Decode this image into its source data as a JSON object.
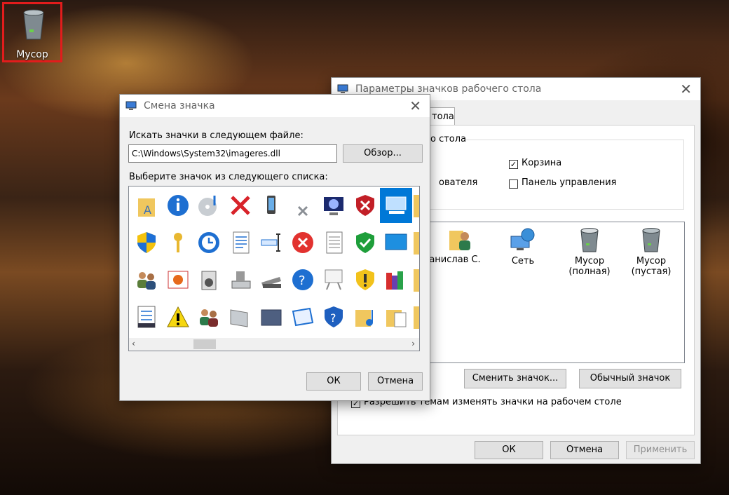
{
  "desktop": {
    "icon_label": "Мусор"
  },
  "settings_dialog": {
    "title": "Параметры значков рабочего стола",
    "tab_label": "тола",
    "group_label": "о стола",
    "check_recycle": "Корзина",
    "check_user": "ователя",
    "check_control_panel": "Панель управления",
    "icons": [
      {
        "label": "анислав С."
      },
      {
        "label": "Сеть"
      },
      {
        "label": "Мусор\n(полная)"
      },
      {
        "label": "Мусор\n(пустая)"
      }
    ],
    "change_icon_btn": "Сменить значок...",
    "default_icon_btn": "Обычный значок",
    "allow_themes": "Разрешить темам изменять значки на рабочем столе",
    "ok_btn": "ОК",
    "cancel_btn": "Отмена",
    "apply_btn": "Применить"
  },
  "change_icon_dialog": {
    "title": "Смена значка",
    "file_label": "Искать значки в следующем файле:",
    "file_value": "C:\\Windows\\System32\\imageres.dll",
    "browse_btn": "Обзор...",
    "list_label": "Выберите значок из следующего списка:",
    "ok_btn": "ОК",
    "cancel_btn": "Отмена",
    "grid_icons": [
      "folder-a-icon",
      "info-icon",
      "music-disc-icon",
      "red-x-icon",
      "phone-icon",
      "small-x-icon",
      "monitor-icon",
      "shield-x-icon",
      "computer-selected-icon",
      "uac-shield-icon",
      "key-icon",
      "clock-sync-icon",
      "document-icon",
      "text-cursor-icon",
      "error-icon",
      "blank-document-icon",
      "shield-check-icon",
      "monitor-blue-icon",
      "users-icon",
      "picture-icon",
      "media-box-icon",
      "drive-icon",
      "scanner-icon",
      "help-icon",
      "presentation-icon",
      "shield-warning-icon",
      "library-icon",
      "checklist-icon",
      "warning-icon",
      "users-2-icon",
      "pipe-icon",
      "folder-dark-icon",
      "slide-icon",
      "shield-help-icon",
      "music-folder-icon",
      "doc-folder-icon"
    ]
  }
}
